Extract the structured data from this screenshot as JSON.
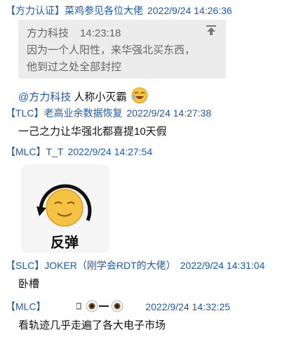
{
  "messages": [
    {
      "sender": "【方力认证】菜鸡参见各位大佬",
      "time": "2022/9/24 14:26:36",
      "quote": {
        "author": "方力科技",
        "time": "14:23:18",
        "lines": [
          "因为一个人阳性，来华强北买东西，",
          "他到过之处全部封控"
        ]
      },
      "mention": "@方力科技",
      "text": "人称小灭霸"
    },
    {
      "sender": "【TLC】老高业余数据恢复",
      "time": "2022/9/24 14:27:38",
      "text": "一己之力让华强北都喜提10天假"
    },
    {
      "sender": "【MLC】T_T",
      "time": "2022/9/24 14:27:54",
      "sticker_text": "反弹"
    },
    {
      "sender": "【SLC】JOKER（刚学会RDT的大佬）",
      "time": "2022/9/24 14:31:04",
      "text": "卧槽"
    },
    {
      "sender": "【MLC】",
      "time": "2022/9/24 14:32:25",
      "text": "看轨迹几乎走遍了各大电子市场"
    }
  ]
}
